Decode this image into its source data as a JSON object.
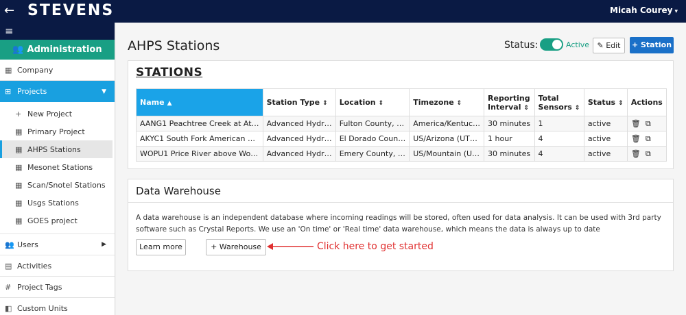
{
  "topbar": {
    "back_icon": "←",
    "logo": "STEVENS",
    "user_name": "Micah Courey",
    "caret": "▾"
  },
  "sidebar": {
    "menu_icon": "≡",
    "section": {
      "icon": "👥",
      "label": "Administration"
    },
    "items": [
      {
        "icon": "▦",
        "label": "Company"
      },
      {
        "icon": "⊞",
        "label": "Projects",
        "chevron": "▼"
      }
    ],
    "project_subitems": [
      {
        "icon": "+",
        "label": "New Project"
      },
      {
        "icon": "▦",
        "label": "Primary Project"
      },
      {
        "icon": "▦",
        "label": "AHPS Stations"
      },
      {
        "icon": "▦",
        "label": "Mesonet Stations"
      },
      {
        "icon": "▦",
        "label": "Scan/Snotel Stations"
      },
      {
        "icon": "▦",
        "label": "Usgs Stations"
      },
      {
        "icon": "▦",
        "label": "GOES project"
      }
    ],
    "bottom_items": [
      {
        "icon": "👥",
        "label": "Users",
        "chevron": "▶"
      },
      {
        "icon": "▤",
        "label": "Activities"
      },
      {
        "icon": "#",
        "label": "Project Tags"
      },
      {
        "icon": "◧",
        "label": "Custom Units"
      }
    ]
  },
  "main": {
    "title": "AHPS Stations",
    "status_label": "Status:",
    "status_value": "Active",
    "edit_label": "✎ Edit",
    "add_station_label": "+ Station",
    "stations_heading": "STATIONS",
    "table": {
      "columns": [
        "Name",
        "Station Type",
        "Location",
        "Timezone",
        "Reporting Interval",
        "Total Sensors",
        "Status",
        "Actions"
      ],
      "rows": [
        [
          "AANG1 Peachtree Creek at At…",
          "Advanced Hydr…",
          "Fulton County, …",
          "America/Kentuc…",
          "30 minutes",
          "1",
          "active"
        ],
        [
          "AKYC1 South Fork American …",
          "Advanced Hydr…",
          "El Dorado Coun…",
          "US/Arizona (UT…",
          "1 hour",
          "4",
          "active"
        ],
        [
          "WOPU1 Price River above Wo…",
          "Advanced Hydr…",
          "Emery County, …",
          "US/Mountain (U…",
          "30 minutes",
          "4",
          "active"
        ]
      ],
      "sort_asc_icon": "▲",
      "sort_icon": "⇕",
      "delete_icon": "🗑",
      "copy_icon": "⧉"
    },
    "data_warehouse": {
      "title": "Data Warehouse",
      "description": "A data warehouse is an independent database where incoming readings will be stored, often used for data analysis. It can be used with 3rd party software such as Crystal Reports. We use an 'On time' or 'Real time' data warehouse, which means the data is always up to date",
      "learn_more_label": "Learn more",
      "warehouse_button_label": "+ Warehouse",
      "annotation": "Click here to get started"
    }
  },
  "colors": {
    "topbar": "#0a1a44",
    "accent_green": "#199f84",
    "accent_blue": "#19a0e0",
    "primary_button": "#1a70c8",
    "annotation_red": "#e03030"
  }
}
